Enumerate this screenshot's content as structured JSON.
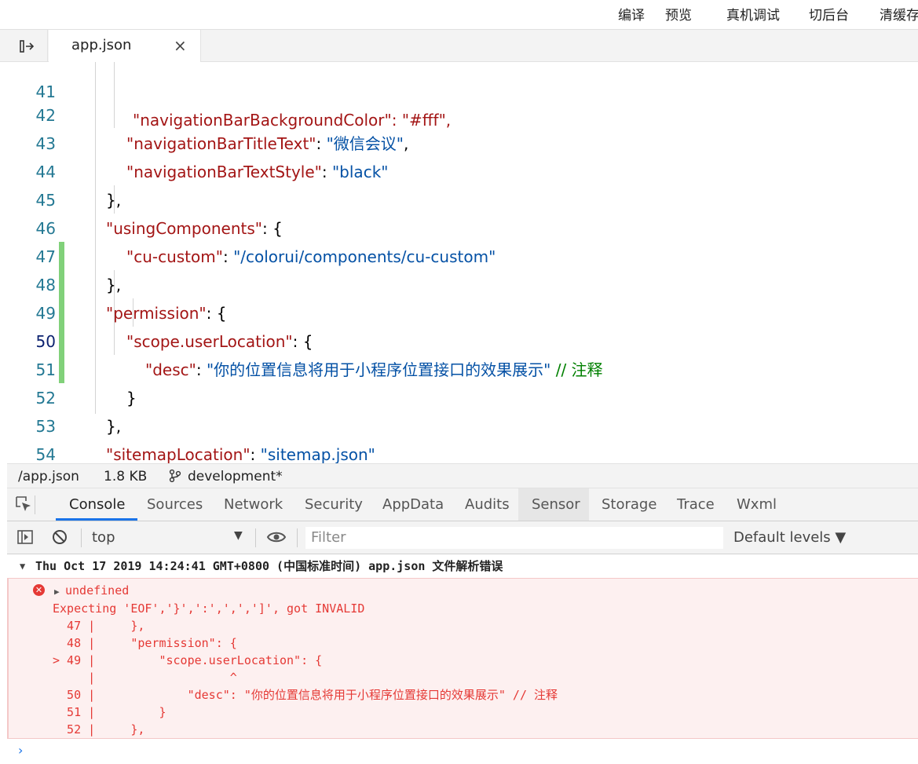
{
  "toolbar": {
    "items": [
      "编译",
      "预览",
      "真机调试",
      "切后台",
      "清缓存"
    ]
  },
  "tabs": {
    "toggle_icon": "sidebar-toggle-icon",
    "file_tab_label": "app.json",
    "close_glyph": "×"
  },
  "editor": {
    "lines": [
      {
        "num": "41",
        "text": "\"navigationBarBackgroundColor\": \"#fff\","
      },
      {
        "num": "42",
        "key": "\"navigationBarTitleText\"",
        "sep": ": ",
        "val": "\"微信会议\"",
        "end": ","
      },
      {
        "num": "43",
        "key": "\"navigationBarTextStyle\"",
        "sep": ": ",
        "val": "\"black\"",
        "end": ""
      },
      {
        "num": "44",
        "plain": "},"
      },
      {
        "num": "45",
        "key": "\"usingComponents\"",
        "sep": ": {",
        "val": "",
        "end": ""
      },
      {
        "num": "46",
        "key": "\"cu-custom\"",
        "sep": ": ",
        "val": "\"/colorui/components/cu-custom\"",
        "end": ""
      },
      {
        "num": "47",
        "plain": "},"
      },
      {
        "num": "48",
        "key": "\"permission\"",
        "sep": ": {",
        "val": "",
        "end": ""
      },
      {
        "num": "49",
        "key": "\"scope.userLocation\"",
        "sep": ": {",
        "val": "",
        "end": ""
      },
      {
        "num": "50",
        "key": "\"desc\"",
        "sep": ": ",
        "val": "\"你的位置信息将用于小程序位置接口的效果展示\"",
        "end": "",
        "comment": " // 注释"
      },
      {
        "num": "51",
        "plain": "}"
      },
      {
        "num": "52",
        "plain": "},"
      },
      {
        "num": "53",
        "key": "\"sitemapLocation\"",
        "sep": ": ",
        "val": "\"sitemap.json\"",
        "end": ""
      },
      {
        "num": "54",
        "plain": "}"
      }
    ]
  },
  "status": {
    "path": "/app.json",
    "size": "1.8 KB",
    "branch": "development*"
  },
  "devtools": {
    "tabs": [
      "Console",
      "Sources",
      "Network",
      "Security",
      "AppData",
      "Audits",
      "Sensor",
      "Storage",
      "Trace",
      "Wxml"
    ],
    "active_tab": "Console",
    "context": "top",
    "filter_placeholder": "Filter",
    "levels": "Default levels ▼"
  },
  "console": {
    "group_header": "Thu Oct 17 2019 14:24:41 GMT+0800 (中国标准时间)  app.json 文件解析错误",
    "error_title": "undefined",
    "error_lines": [
      "Expecting 'EOF','}',':',',',']', got INVALID",
      "  47 |     },",
      "  48 |     \"permission\": {",
      "> 49 |         \"scope.userLocation\": {",
      "     |                   ^",
      "  50 |             \"desc\": \"你的位置信息将用于小程序位置接口的效果展示\" // 注释",
      "  51 |         }",
      "  52 |     },"
    ],
    "prompt": "›"
  }
}
